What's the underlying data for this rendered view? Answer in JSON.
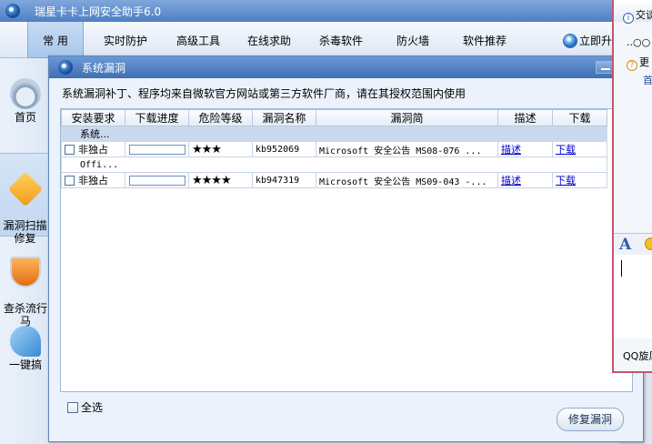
{
  "app": {
    "title": "瑞星卡卡上网安全助手6.0",
    "menu": [
      {
        "label": "常 用"
      },
      {
        "label": "实时防护"
      },
      {
        "label": "高级工具"
      },
      {
        "label": "在线求助"
      },
      {
        "label": "杀毒软件"
      },
      {
        "label": "防火墙"
      },
      {
        "label": "软件推荐"
      },
      {
        "label": "立即升"
      }
    ],
    "sidebar": [
      {
        "label": "首页"
      },
      {
        "label": "漏洞扫描\n修复"
      },
      {
        "label": "查杀流行\n马"
      },
      {
        "label": "一键搞"
      }
    ]
  },
  "dialog": {
    "title": "系统漏洞",
    "description": "系统漏洞补丁、程序均来自微软官方网站或第三方软件厂商，请在其授权范围内使用",
    "columns": [
      "安装要求",
      "下载进度",
      "危险等级",
      "漏洞名称",
      "漏洞简",
      "描述",
      "下载"
    ],
    "groups": [
      {
        "name": "系统...",
        "rows": [
          {
            "requirement": "非独占",
            "progress": 0,
            "risk": "★★★",
            "name": "kb952069",
            "summary": "Microsoft 安全公告 MS08-076 ...",
            "desc_link": "描述",
            "download_link": "下载"
          }
        ]
      },
      {
        "name": "Offi...",
        "rows": [
          {
            "requirement": "非独占",
            "progress": 0,
            "risk": "★★★★",
            "name": "kb947319",
            "summary": "Microsoft 安全公告 MS09-043 -...",
            "desc_link": "描述",
            "download_link": "下载"
          }
        ]
      }
    ],
    "select_all_label": "全选",
    "repair_label": "修复漏洞"
  },
  "qq": {
    "line1": "交谈",
    "line2": "..○○",
    "line3": "更",
    "line4": "首",
    "footer": "QQ旋风"
  },
  "colors": {
    "titlebar": "#4f7fc4",
    "link": "#0000cc",
    "group_row": "#c9d9ee",
    "qq_border": "#c8546e"
  }
}
